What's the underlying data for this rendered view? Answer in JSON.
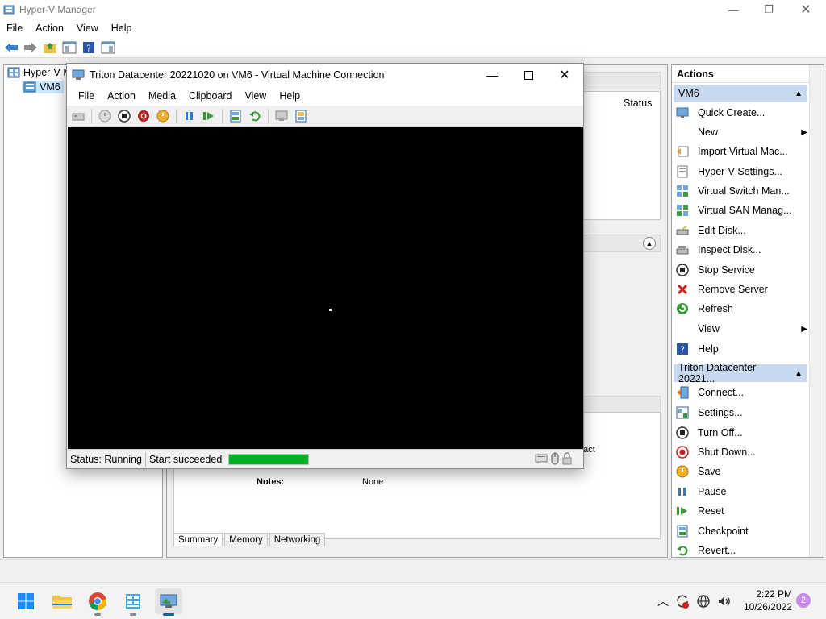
{
  "manager": {
    "title": "Hyper-V Manager",
    "menu": [
      "File",
      "Action",
      "View",
      "Help"
    ],
    "tree": {
      "root": "Hyper-V M",
      "server": "VM6"
    },
    "center": {
      "status_header": "Status",
      "notes_label": "Notes:",
      "notes_value": "None",
      "partial_text": "ntact"
    },
    "tabs": [
      "Summary",
      "Memory",
      "Networking"
    ],
    "actions": {
      "header": "Actions",
      "server_section": "VM6",
      "server_items": [
        {
          "label": "Quick Create...",
          "icon": "quick-create-icon"
        },
        {
          "label": "New",
          "icon": "new-icon",
          "submenu": true
        },
        {
          "label": "Import Virtual Mac...",
          "icon": "import-icon"
        },
        {
          "label": "Hyper-V Settings...",
          "icon": "settings-icon"
        },
        {
          "label": "Virtual Switch Man...",
          "icon": "switch-icon"
        },
        {
          "label": "Virtual SAN Manag...",
          "icon": "san-icon"
        },
        {
          "label": "Edit Disk...",
          "icon": "edit-disk-icon"
        },
        {
          "label": "Inspect Disk...",
          "icon": "inspect-disk-icon"
        },
        {
          "label": "Stop Service",
          "icon": "stop-icon"
        },
        {
          "label": "Remove Server",
          "icon": "remove-icon"
        },
        {
          "label": "Refresh",
          "icon": "refresh-icon"
        },
        {
          "label": "View",
          "icon": "view-icon",
          "submenu": true
        },
        {
          "label": "Help",
          "icon": "help-icon"
        }
      ],
      "vm_section": "Triton Datacenter 20221...",
      "vm_items": [
        {
          "label": "Connect...",
          "icon": "connect-icon"
        },
        {
          "label": "Settings...",
          "icon": "vm-settings-icon"
        },
        {
          "label": "Turn Off...",
          "icon": "turn-off-icon"
        },
        {
          "label": "Shut Down...",
          "icon": "shutdown-icon"
        },
        {
          "label": "Save",
          "icon": "save-icon"
        },
        {
          "label": "Pause",
          "icon": "pause-icon"
        },
        {
          "label": "Reset",
          "icon": "reset-icon"
        },
        {
          "label": "Checkpoint",
          "icon": "checkpoint-icon"
        },
        {
          "label": "Revert...",
          "icon": "revert-icon"
        }
      ]
    }
  },
  "vm_connection": {
    "title": "Triton Datacenter 20221020 on VM6 - Virtual Machine Connection",
    "menu": [
      "File",
      "Action",
      "Media",
      "Clipboard",
      "View",
      "Help"
    ],
    "status_label": "Status: Running",
    "status_message": "Start succeeded",
    "progress": 1.0
  },
  "taskbar": {
    "time": "2:22 PM",
    "date": "10/26/2022",
    "notification_count": "2"
  },
  "colors": {
    "accent": "#005fb8",
    "section_header": "#c8d8ee",
    "progress_green": "#06b025",
    "selection": "#cce8ff"
  }
}
